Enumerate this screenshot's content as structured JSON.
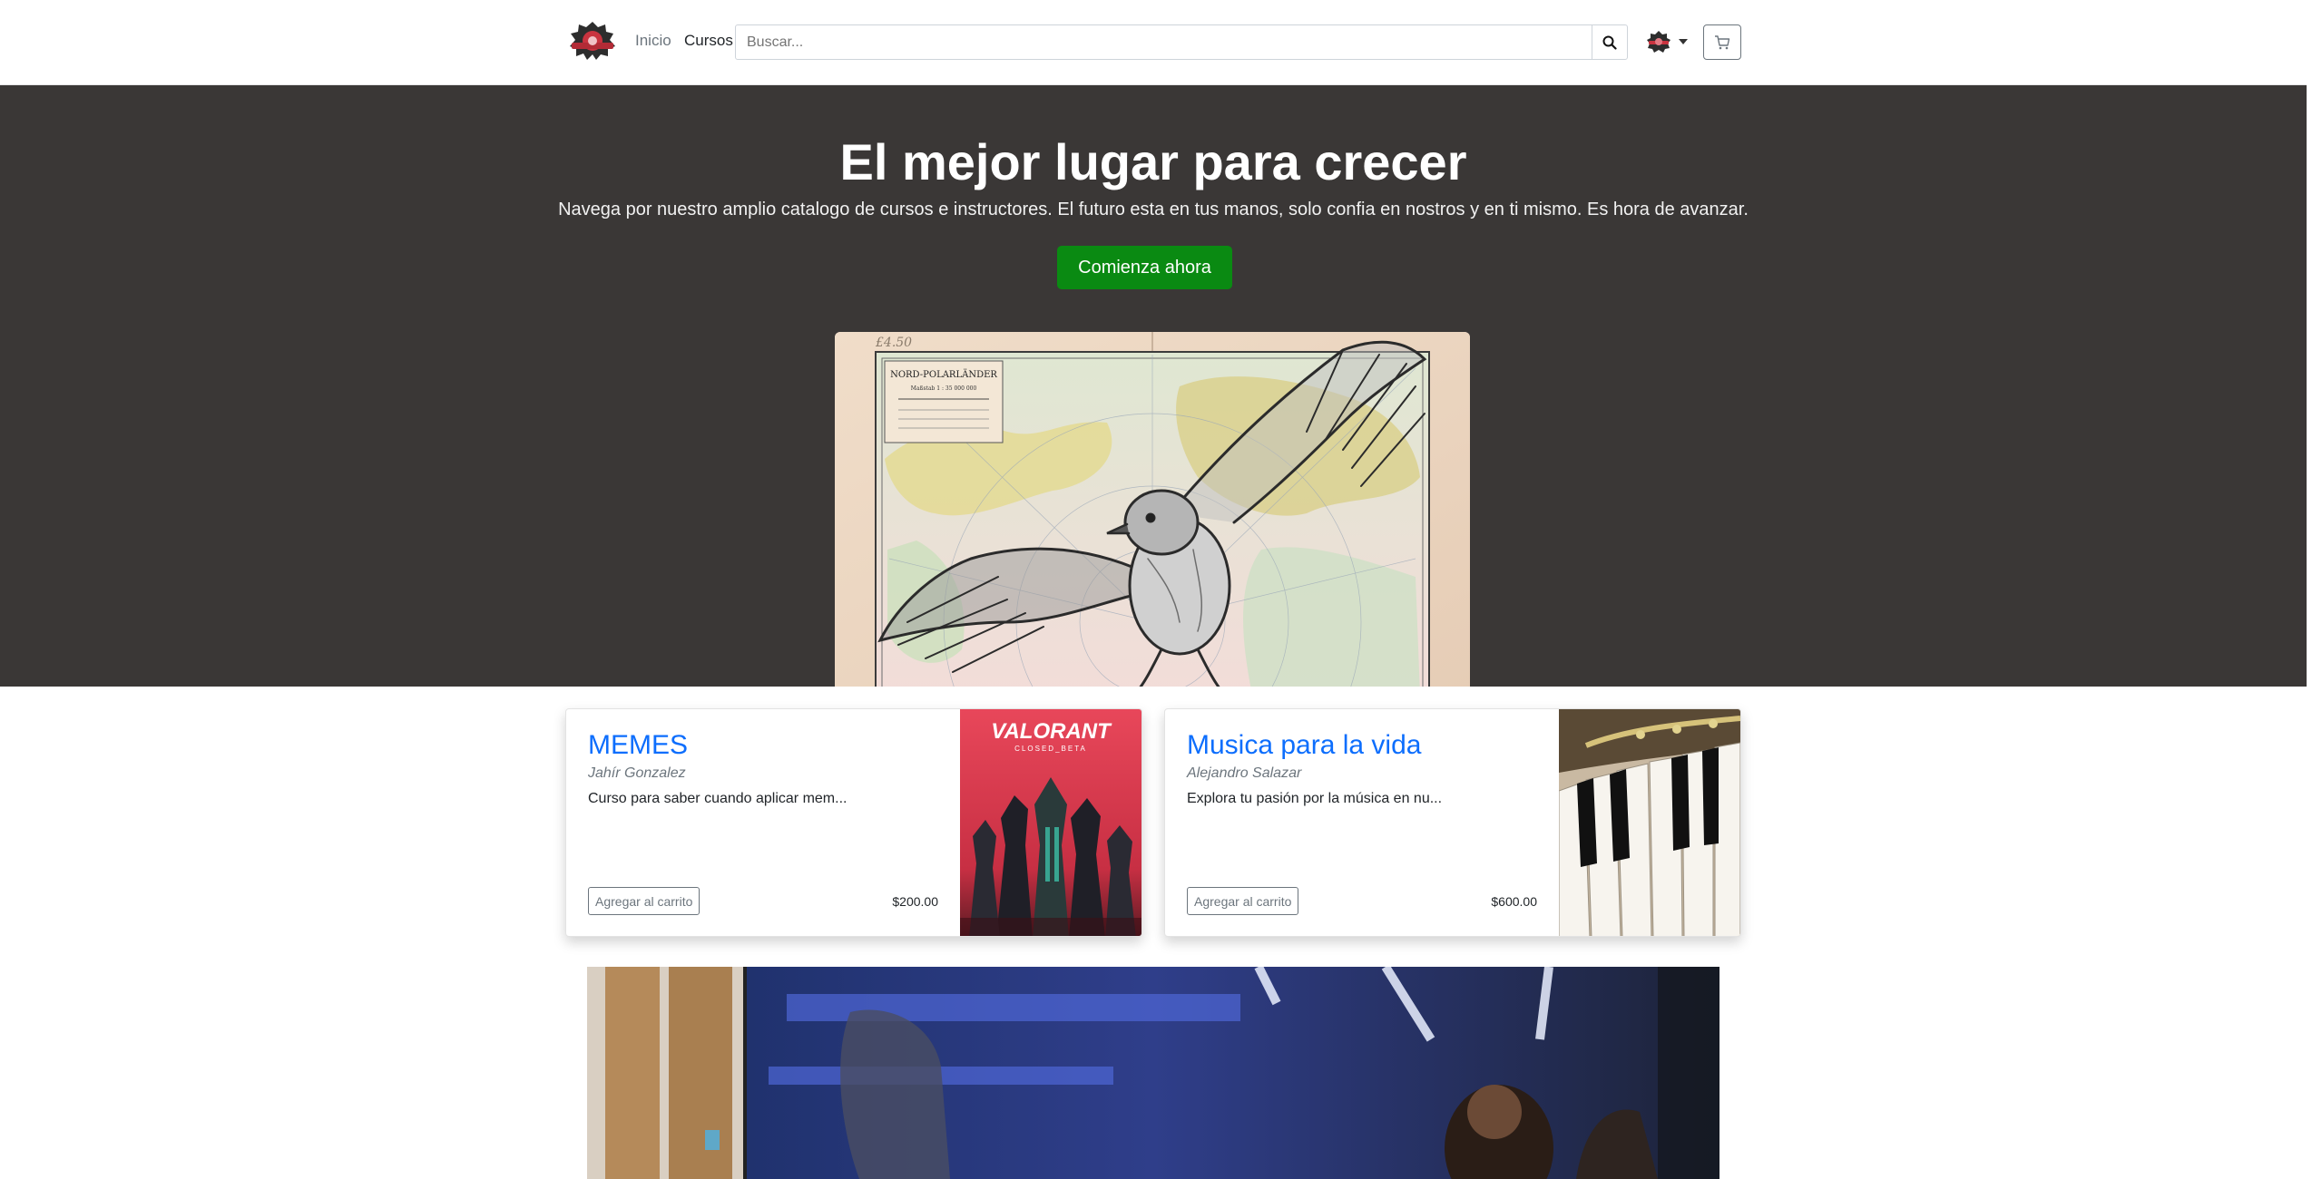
{
  "navbar": {
    "logo_alt": "Logo",
    "links": [
      {
        "label": "Inicio"
      },
      {
        "label": "Cursos"
      }
    ],
    "search": {
      "placeholder": "Buscar...",
      "value": ""
    }
  },
  "hero": {
    "title": "El mejor lugar para crecer",
    "subtitle": "Navega por nuestro amplio catalogo de cursos e instructores. El futuro esta en tus manos, solo confia en nostros y en ti mismo. Es hora de avanzar.",
    "cta_label": "Comienza ahora"
  },
  "courses": [
    {
      "title": "MEMES",
      "author": "Jahír Gonzalez",
      "description": "Curso para saber cuando aplicar mem...",
      "add_label": "Agregar al carrito",
      "price": "$200.00",
      "image_text": "VALORANT",
      "image_subtext": "CLOSED_BETA"
    },
    {
      "title": "Musica para la vida",
      "author": "Alejandro Salazar",
      "description": "Explora tu pasión por la música en nu...",
      "add_label": "Agregar al carrito",
      "price": "$600.00"
    }
  ],
  "map_labels": {
    "top": "NORD-POLARLÄNDER",
    "scale": "Maßstab 1 : 35 000 000"
  },
  "colors": {
    "hero_bg": "#3a3736",
    "cta": "#0a8a12",
    "link": "#0d6efd"
  },
  "icons": [
    "search-icon",
    "user-avatar-icon",
    "caret-down-icon",
    "cart-icon"
  ]
}
